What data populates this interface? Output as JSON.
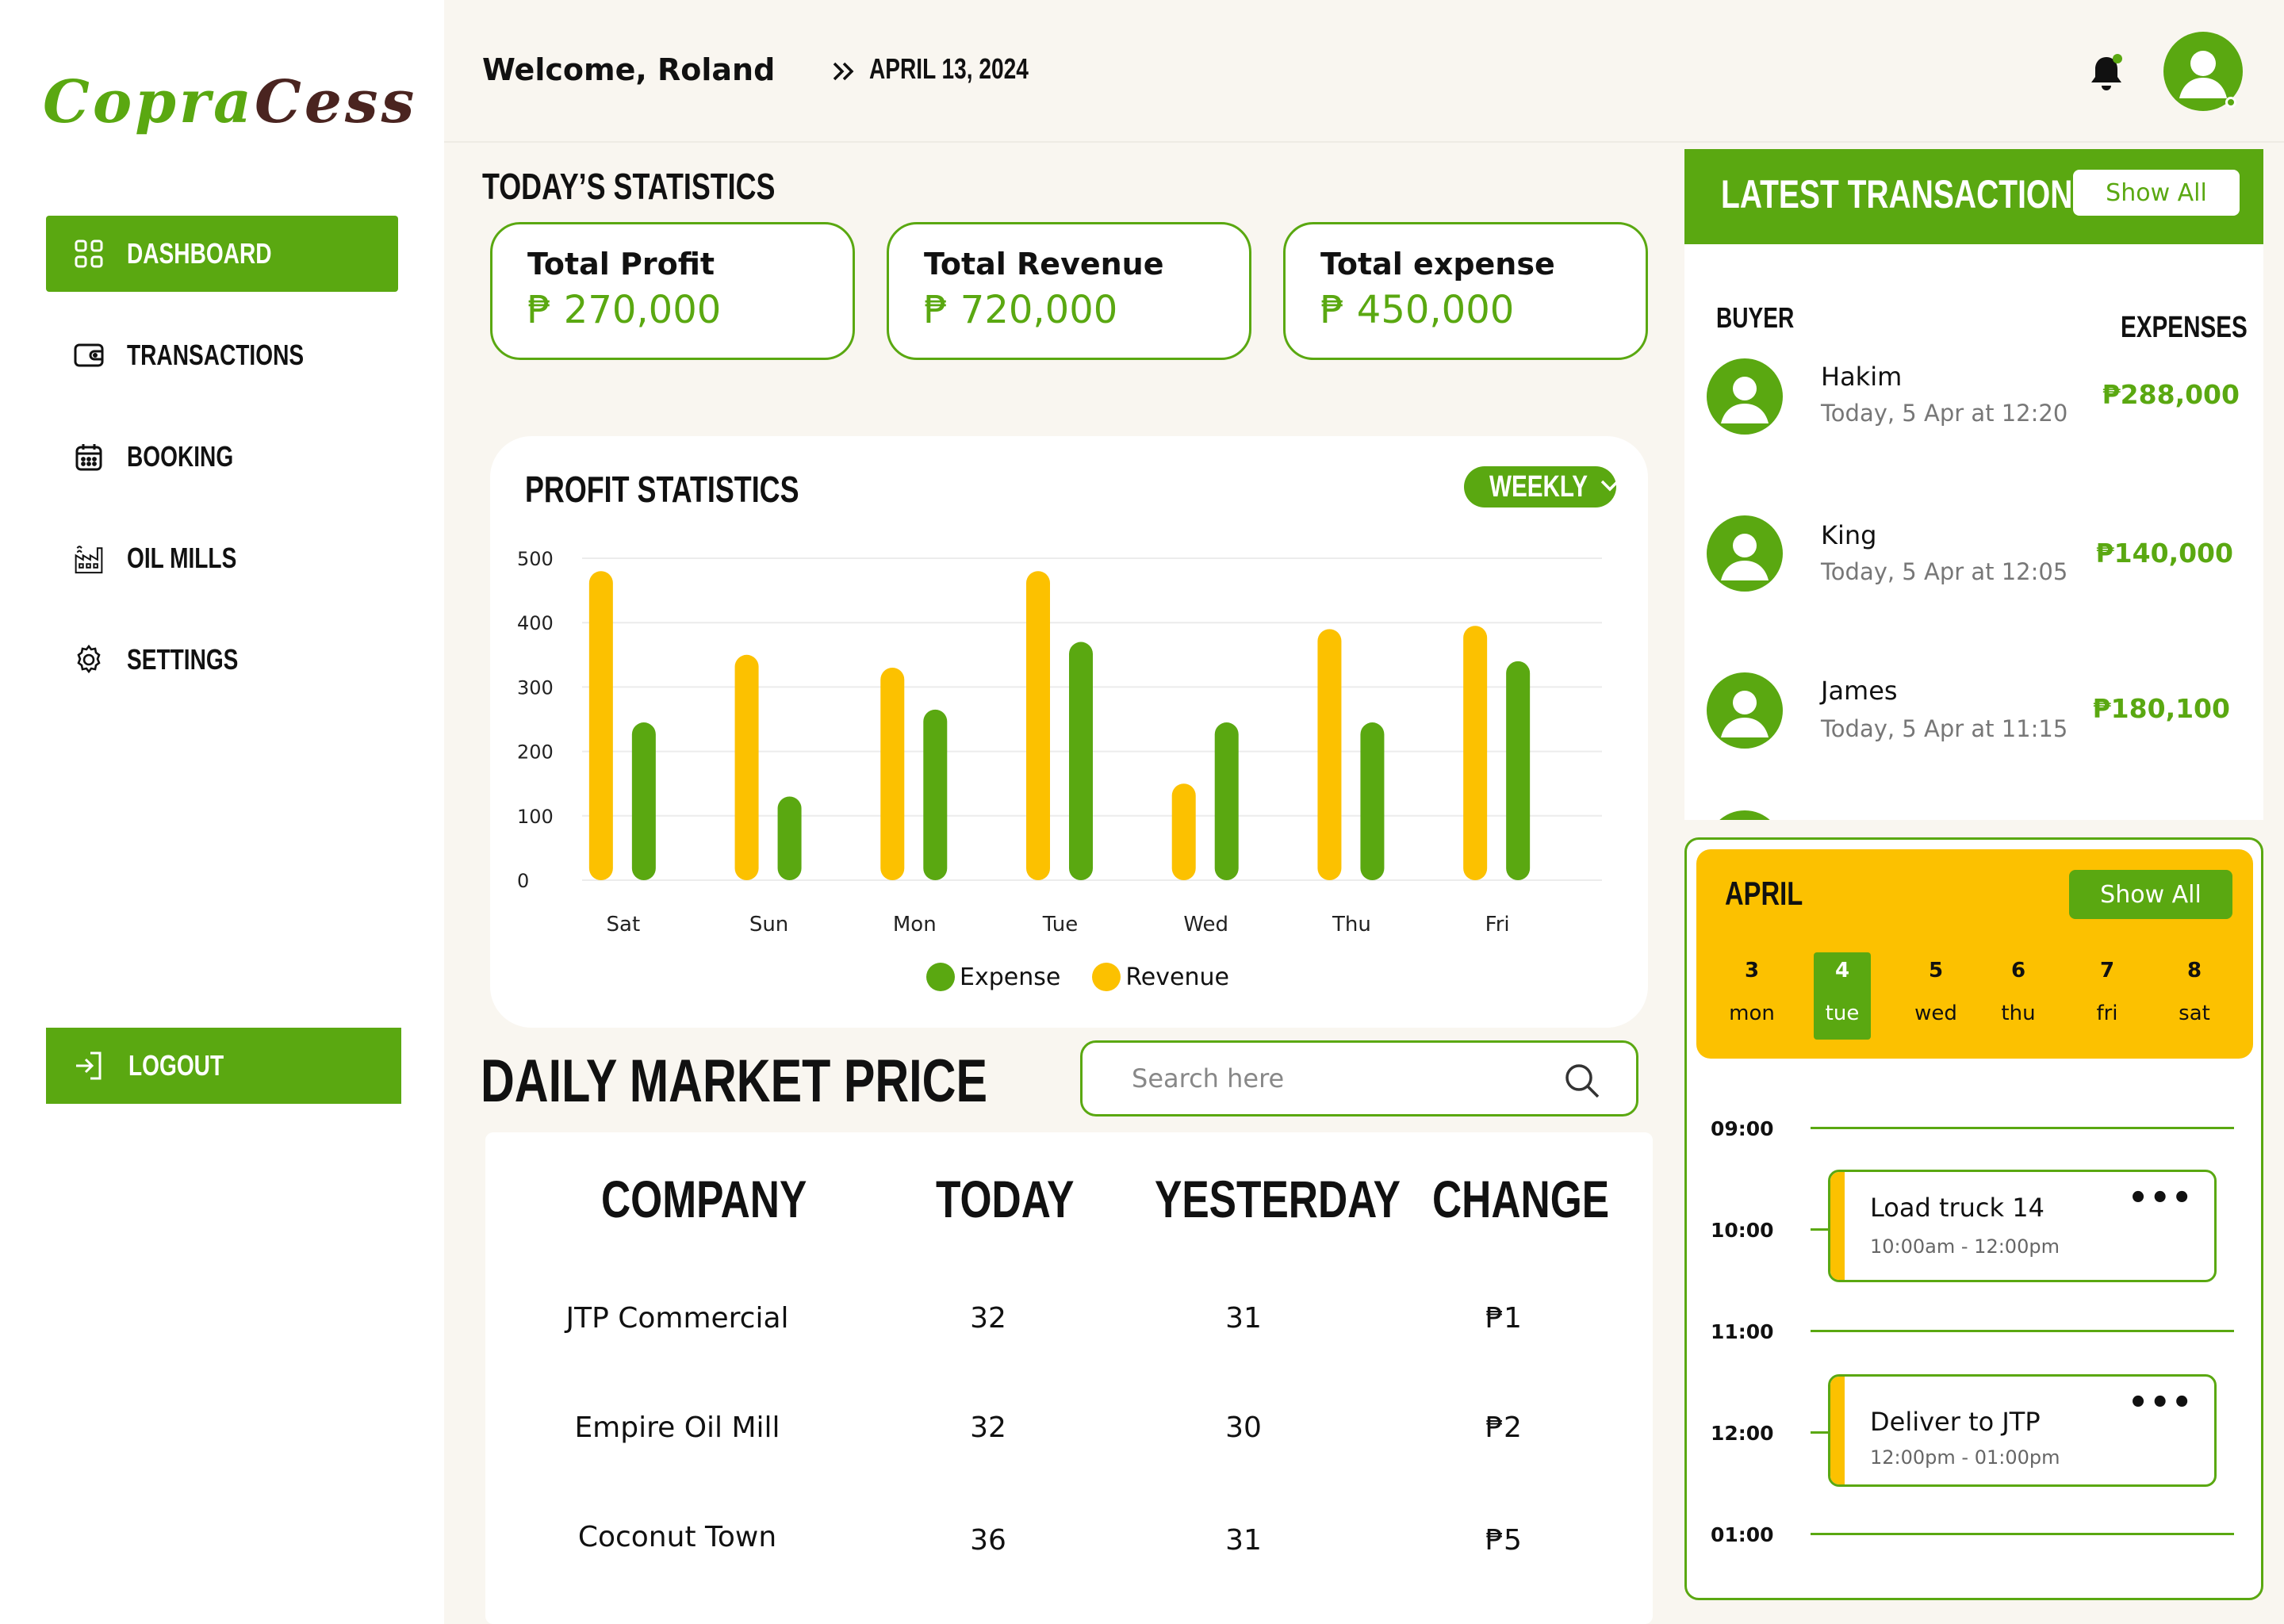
{
  "app": {
    "logo_part1": "Copra",
    "logo_part2": "Cess"
  },
  "sidebar": {
    "items": [
      {
        "label": "DASHBOARD",
        "icon": "grid-icon",
        "active": true
      },
      {
        "label": "TRANSACTIONS",
        "icon": "wallet-icon",
        "active": false
      },
      {
        "label": "BOOKING",
        "icon": "calendar-icon",
        "active": false
      },
      {
        "label": "OIL MILLS",
        "icon": "factory-icon",
        "active": false
      },
      {
        "label": "SETTINGS",
        "icon": "gear-icon",
        "active": false
      }
    ],
    "logout_label": "LOGOUT"
  },
  "header": {
    "welcome": "Welcome, Roland",
    "date": "APRIL 13, 2024"
  },
  "stats": {
    "title": "TODAY’S STATISTICS",
    "cards": [
      {
        "label": "Total Profit",
        "value": "₱  270,000"
      },
      {
        "label": "Total Revenue",
        "value": "₱  720,000"
      },
      {
        "label": "Total expense",
        "value": "₱  450,000"
      }
    ]
  },
  "profit_chart": {
    "title": "PROFIT STATISTICS",
    "period": "WEEKLY",
    "legend": [
      "Expense",
      "Revenue"
    ]
  },
  "chart_data": {
    "type": "bar",
    "title": "PROFIT STATISTICS",
    "categories": [
      "Sat",
      "Sun",
      "Mon",
      "Tue",
      "Wed",
      "Thu",
      "Fri"
    ],
    "series": [
      {
        "name": "Revenue",
        "color": "#fcc100",
        "values": [
          480,
          350,
          330,
          480,
          150,
          390,
          395
        ]
      },
      {
        "name": "Expense",
        "color": "#5aa811",
        "values": [
          245,
          130,
          265,
          370,
          245,
          245,
          340
        ]
      }
    ],
    "yticks": [
      0,
      100,
      200,
      300,
      400,
      500
    ],
    "ylim": [
      0,
      500
    ],
    "grid": true,
    "legend_position": "bottom"
  },
  "market": {
    "title": "DAILY MARKET PRICE",
    "search_placeholder": "Search here",
    "columns": [
      "COMPANY",
      "TODAY",
      "YESTERDAY",
      "CHANGE"
    ],
    "rows": [
      {
        "company": "JTP Commercial",
        "today": "32",
        "yesterday": "31",
        "change": "₱1"
      },
      {
        "company": "Empire Oil Mill",
        "today": "32",
        "yesterday": "30",
        "change": "₱2"
      },
      {
        "company": "Coconut Town",
        "today": "36",
        "yesterday": "31",
        "change": "₱5"
      }
    ]
  },
  "transactions": {
    "title": "LATEST TRANSACTION",
    "show_all": "Show All",
    "col_buyer": "BUYER",
    "col_expenses": "EXPENSES",
    "items": [
      {
        "name": "Hakim",
        "time": "Today, 5 Apr at 12:20",
        "amount": "₱288,000"
      },
      {
        "name": "King",
        "time": "Today, 5 Apr at 12:05",
        "amount": "₱140,000"
      },
      {
        "name": "James",
        "time": "Today, 5 Apr at 11:15",
        "amount": "₱180,100"
      }
    ]
  },
  "calendar": {
    "month": "APRIL",
    "show_all": "Show All",
    "days": [
      {
        "num": "3",
        "wd": "mon",
        "selected": false
      },
      {
        "num": "4",
        "wd": "tue",
        "selected": true
      },
      {
        "num": "5",
        "wd": "wed",
        "selected": false
      },
      {
        "num": "6",
        "wd": "thu",
        "selected": false
      },
      {
        "num": "7",
        "wd": "fri",
        "selected": false
      },
      {
        "num": "8",
        "wd": "sat",
        "selected": false
      }
    ],
    "times": [
      "09:00",
      "10:00",
      "11:00",
      "12:00",
      "01:00"
    ],
    "events": [
      {
        "title": "Load truck 14",
        "time": "10:00am - 12:00pm"
      },
      {
        "title": "Deliver to JTP",
        "time": "12:00pm - 01:00pm"
      }
    ],
    "more_label": "•••"
  }
}
